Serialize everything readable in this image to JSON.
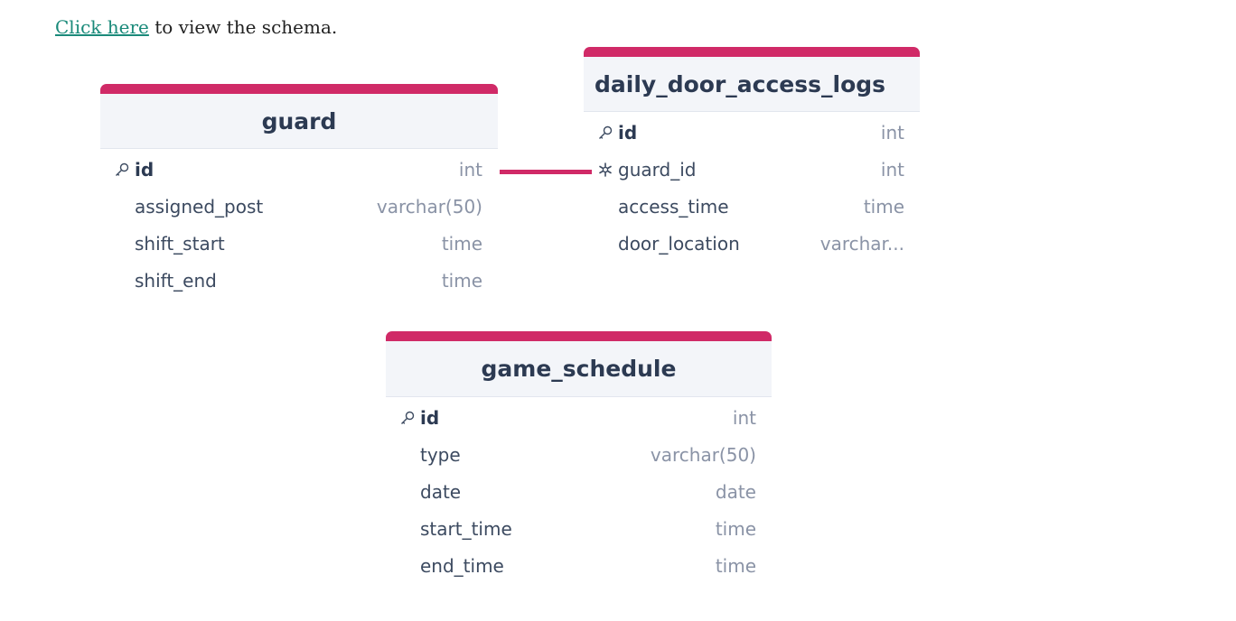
{
  "intro": {
    "link_text": "Click here",
    "rest_text": " to view the schema."
  },
  "tables": {
    "guard": {
      "name": "guard",
      "fields": [
        {
          "name": "id",
          "type": "int"
        },
        {
          "name": "assigned_post",
          "type": "varchar(50)"
        },
        {
          "name": "shift_start",
          "type": "time"
        },
        {
          "name": "shift_end",
          "type": "time"
        }
      ]
    },
    "daily_door_access_logs": {
      "name": "daily_door_access_logs",
      "fields": [
        {
          "name": "id",
          "type": "int"
        },
        {
          "name": "guard_id",
          "type": "int"
        },
        {
          "name": "access_time",
          "type": "time"
        },
        {
          "name": "door_location",
          "type": "varchar..."
        }
      ]
    },
    "game_schedule": {
      "name": "game_schedule",
      "fields": [
        {
          "name": "id",
          "type": "int"
        },
        {
          "name": "type",
          "type": "varchar(50)"
        },
        {
          "name": "date",
          "type": "date"
        },
        {
          "name": "start_time",
          "type": "time"
        },
        {
          "name": "end_time",
          "type": "time"
        }
      ]
    }
  },
  "icons": {
    "primary_key": "key-icon",
    "foreign_key": "snowflake-icon"
  },
  "colors": {
    "accent": "#d02a67",
    "link": "#1a8a7a",
    "header_bg": "#f3f5f9"
  }
}
